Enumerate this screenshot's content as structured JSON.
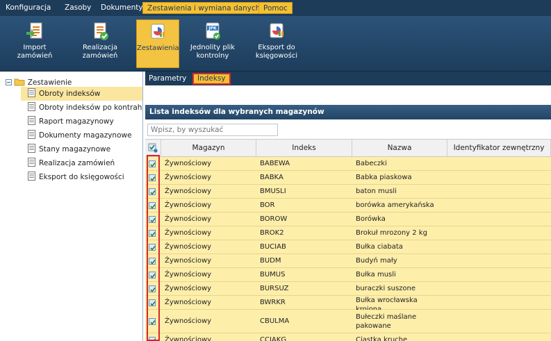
{
  "menu": [
    "Konfiguracja",
    "Zasoby",
    "Dokumenty",
    "Zestawienia i wymiana danych",
    "Pomoc"
  ],
  "ribbon": [
    {
      "label": "Import\nzamówień",
      "icon": "import-orders-icon"
    },
    {
      "label": "Realizacja\nzamówień",
      "icon": "order-fulfillment-icon"
    },
    {
      "label": "Zestawienia",
      "icon": "reports-icon"
    },
    {
      "label": "Jednolity plik\nkontrolny",
      "icon": "jpk-file-icon",
      "badge": "JPK"
    },
    {
      "label": "Eksport do\nksięgowości",
      "icon": "accounting-export-icon"
    }
  ],
  "tree": {
    "root": "Zestawienie",
    "items": [
      "Obroty indeksów",
      "Obroty indeksów po kontrahentach",
      "Raport magazynowy",
      "Dokumenty magazynowe",
      "Stany magazynowe",
      "Realizacja zamówień",
      "Eksport do księgowości"
    ],
    "selected": "Obroty indeksów"
  },
  "subtabs": [
    "Parametry",
    "Indeksy"
  ],
  "list": {
    "title": "Lista indeksów dla wybranych magazynów",
    "search_placeholder": "Wpisz, by wyszukać",
    "columns": [
      "Magazyn",
      "Indeks",
      "Nazwa",
      "Identyfikator zewnętrzny"
    ],
    "rows": [
      {
        "magazyn": "Żywnościowy",
        "indeks": "BABEWA",
        "nazwa": "Babeczki",
        "checked": true
      },
      {
        "magazyn": "Żywnościowy",
        "indeks": "BABKA",
        "nazwa": "Babka piaskowa",
        "checked": true
      },
      {
        "magazyn": "Żywnościowy",
        "indeks": "BMUSLI",
        "nazwa": "baton musli",
        "checked": true
      },
      {
        "magazyn": "Żywnościowy",
        "indeks": "BOR",
        "nazwa": "borówka amerykańska",
        "checked": true
      },
      {
        "magazyn": "Żywnościowy",
        "indeks": "BOROW",
        "nazwa": "Borówka",
        "checked": true
      },
      {
        "magazyn": "Żywnościowy",
        "indeks": "BROK2",
        "nazwa": "Brokuł mrozony 2 kg",
        "checked": true
      },
      {
        "magazyn": "Żywnościowy",
        "indeks": "BUCIAB",
        "nazwa": "Bułka ciabata",
        "checked": true
      },
      {
        "magazyn": "Żywnościowy",
        "indeks": "BUDM",
        "nazwa": "Budyń mały",
        "checked": true
      },
      {
        "magazyn": "Żywnościowy",
        "indeks": "BUMUS",
        "nazwa": "Bułka musli",
        "checked": true
      },
      {
        "magazyn": "Żywnościowy",
        "indeks": "BURSUZ",
        "nazwa": "buraczki suszone",
        "checked": true
      },
      {
        "magazyn": "Żywnościowy",
        "indeks": "BWRKR",
        "nazwa": "Bułka wrocławska krojona",
        "checked": true
      },
      {
        "magazyn": "Żywnościowy",
        "indeks": "CBULMA",
        "nazwa": "Bułeczki maślane pakowane",
        "checked": true
      },
      {
        "magazyn": "Żywnościowy",
        "indeks": "CCIAKG",
        "nazwa": "Ciastka kruche",
        "checked": true
      }
    ]
  },
  "colors": {
    "nav": "#1d3c59",
    "accent": "#f6c033",
    "row": "#fdeeaa",
    "highlight": "#d8262e"
  }
}
